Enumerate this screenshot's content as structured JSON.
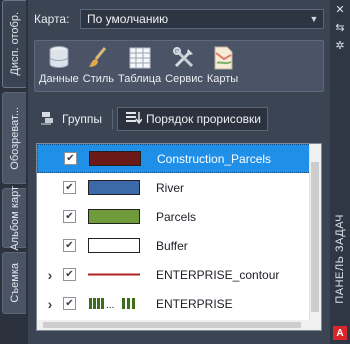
{
  "vtabs": [
    {
      "label": "Дисп. отобр."
    },
    {
      "label": "Обозреват..."
    },
    {
      "label": "Альбом карт"
    },
    {
      "label": "Съемка"
    }
  ],
  "map": {
    "label": "Карта:",
    "value": "По умолчанию"
  },
  "ribbon": [
    {
      "label": "Данные",
      "icon": "database-icon"
    },
    {
      "label": "Стиль",
      "icon": "paintbrush-icon"
    },
    {
      "label": "Таблица",
      "icon": "table-icon"
    },
    {
      "label": "Сервис",
      "icon": "tools-icon"
    },
    {
      "label": "Карты",
      "icon": "map-icon"
    }
  ],
  "toolbar2": {
    "groups_label": "Группы",
    "draw_order_label": "Порядок прорисовки"
  },
  "layers": [
    {
      "name": "Construction_Parcels",
      "checked": true,
      "symbol": "fill",
      "color": "#6b1a1a",
      "selected": true
    },
    {
      "name": "River",
      "checked": true,
      "symbol": "fill",
      "color": "#3c6aa8"
    },
    {
      "name": "Parcels",
      "checked": true,
      "symbol": "fill",
      "color": "#6f9b3a"
    },
    {
      "name": "Buffer",
      "checked": true,
      "symbol": "fill",
      "color": "#ffffff"
    },
    {
      "name": "ENTERPRISE_contour",
      "checked": true,
      "symbol": "line",
      "color": "#b02020",
      "expandable": true
    },
    {
      "name": "ENTERPRISE",
      "checked": true,
      "symbol": "points",
      "color": "#3d6e1e",
      "expandable": true
    }
  ],
  "panel_title": "ПАНЕЛЬ ЗАДАЧ",
  "colors": {
    "accent": "#1f8fe8",
    "panel": "#3b4453"
  }
}
